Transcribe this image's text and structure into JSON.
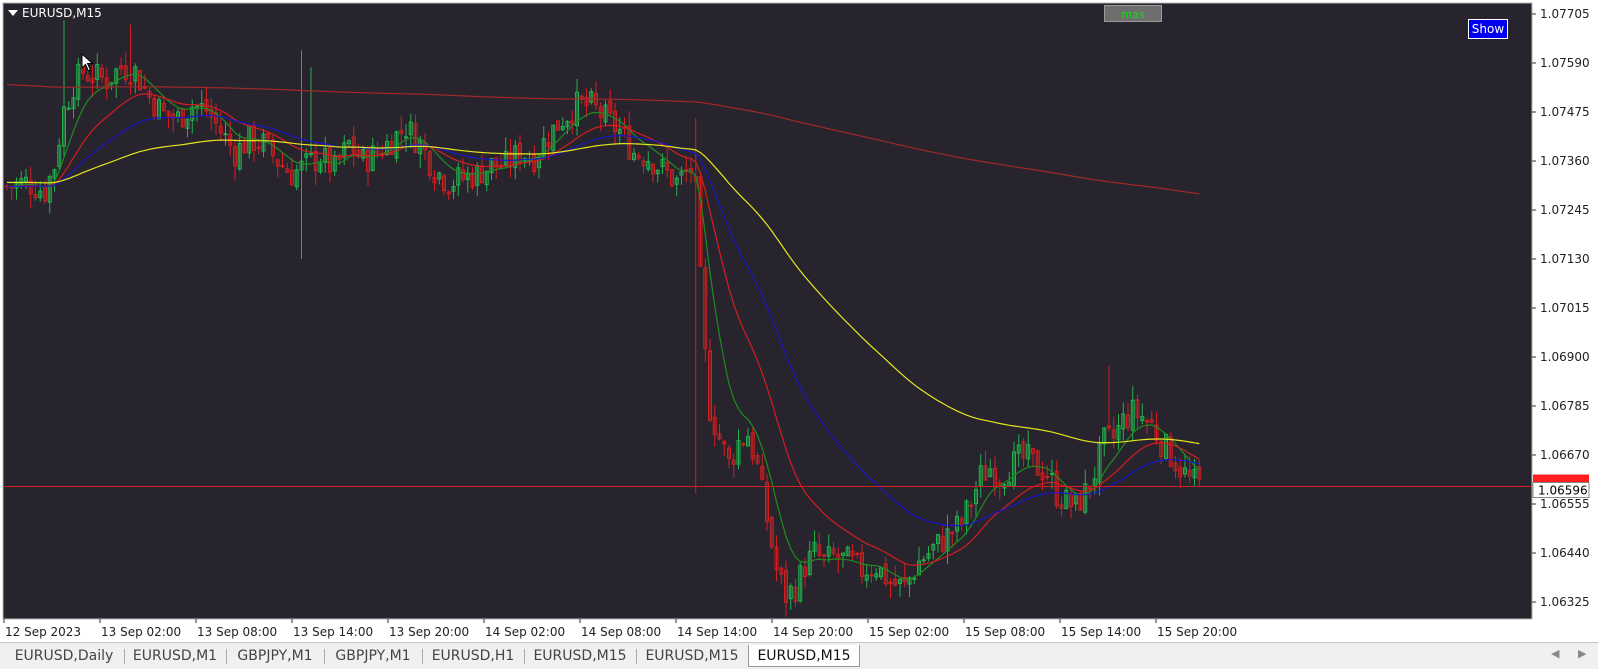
{
  "window": {
    "symbol_label": "EURUSD,M15"
  },
  "buttons": {
    "mas_label": "mas",
    "show_label": "Show"
  },
  "price_axis": {
    "labels": [
      "1.07705",
      "1.07590",
      "1.07475",
      "1.07360",
      "1.07245",
      "1.07130",
      "1.07015",
      "1.06900",
      "1.06785",
      "1.06670",
      "1.06555",
      "1.06440",
      "1.06325"
    ],
    "current_price": "1.06596"
  },
  "time_axis": {
    "labels": [
      "12 Sep 2023",
      "13 Sep 02:00",
      "13 Sep 08:00",
      "13 Sep 14:00",
      "13 Sep 20:00",
      "14 Sep 02:00",
      "14 Sep 08:00",
      "14 Sep 14:00",
      "14 Sep 20:00",
      "15 Sep 02:00",
      "15 Sep 08:00",
      "15 Sep 14:00",
      "15 Sep 20:00"
    ]
  },
  "tabs": [
    {
      "label": "EURUSD,Daily",
      "active": false
    },
    {
      "label": "EURUSD,M1",
      "active": false
    },
    {
      "label": "GBPJPY,M1",
      "active": false
    },
    {
      "label": "GBPJPY,M1",
      "active": false
    },
    {
      "label": "EURUSD,H1",
      "active": false
    },
    {
      "label": "EURUSD,M15",
      "active": false
    },
    {
      "label": "EURUSD,M15",
      "active": false
    },
    {
      "label": "EURUSD,M15",
      "active": true
    }
  ],
  "colors": {
    "background": "#28242e",
    "bull": "#22b14c",
    "bear": "#d21e1e",
    "ma_fast": "#1e8c1e",
    "ma_mid": "#d21e1e",
    "ma_slow": "#1818c8",
    "ma_200": "#e6e61e",
    "ma_long": "#a02828",
    "current_line": "#d21e1e"
  },
  "chart_data": {
    "type": "candlestick",
    "symbol": "EURUSD",
    "timeframe": "M15",
    "ylim": [
      1.0627,
      1.0776
    ],
    "x_ticks": [
      "12 Sep 2023",
      "13 Sep 02:00",
      "13 Sep 08:00",
      "13 Sep 14:00",
      "13 Sep 20:00",
      "14 Sep 02:00",
      "14 Sep 08:00",
      "14 Sep 14:00",
      "14 Sep 20:00",
      "15 Sep 02:00",
      "15 Sep 08:00",
      "15 Sep 14:00",
      "15 Sep 20:00"
    ],
    "y_ticks": [
      1.07705,
      1.0759,
      1.07475,
      1.0736,
      1.07245,
      1.0713,
      1.07015,
      1.069,
      1.06785,
      1.0667,
      1.06555,
      1.0644,
      1.06325
    ],
    "current_price": 1.06596,
    "close_path": [
      [
        0,
        1.073
      ],
      [
        4,
        1.0731
      ],
      [
        8,
        1.0729
      ],
      [
        10,
        1.0735
      ],
      [
        12,
        1.0748
      ],
      [
        14,
        1.0754
      ],
      [
        16,
        1.0757
      ],
      [
        18,
        1.0756
      ],
      [
        21,
        1.0755
      ],
      [
        24,
        1.0758
      ],
      [
        27,
        1.0757
      ],
      [
        30,
        1.0751
      ],
      [
        33,
        1.0747
      ],
      [
        36,
        1.0746
      ],
      [
        39,
        1.0749
      ],
      [
        42,
        1.0748
      ],
      [
        45,
        1.0743
      ],
      [
        48,
        1.0738
      ],
      [
        51,
        1.0741
      ],
      [
        54,
        1.074
      ],
      [
        57,
        1.0736
      ],
      [
        60,
        1.0733
      ],
      [
        63,
        1.0735
      ],
      [
        66,
        1.0737
      ],
      [
        69,
        1.0734
      ],
      [
        72,
        1.074
      ],
      [
        75,
        1.0736
      ],
      [
        78,
        1.0738
      ],
      [
        81,
        1.0741
      ],
      [
        84,
        1.0744
      ],
      [
        87,
        1.074
      ],
      [
        90,
        1.0734
      ],
      [
        93,
        1.0731
      ],
      [
        96,
        1.0732
      ],
      [
        99,
        1.0733
      ],
      [
        102,
        1.0735
      ],
      [
        105,
        1.0735
      ],
      [
        108,
        1.0738
      ],
      [
        111,
        1.0737
      ],
      [
        114,
        1.0742
      ],
      [
        117,
        1.0746
      ],
      [
        120,
        1.0749
      ],
      [
        123,
        1.0749
      ],
      [
        126,
        1.0746
      ],
      [
        129,
        1.0743
      ],
      [
        132,
        1.0738
      ],
      [
        135,
        1.0737
      ],
      [
        138,
        1.0734
      ],
      [
        141,
        1.0731
      ],
      [
        144,
        1.0734
      ],
      [
        145,
        1.0728
      ],
      [
        146,
        1.0708
      ],
      [
        147,
        1.069
      ],
      [
        148,
        1.0678
      ],
      [
        150,
        1.0671
      ],
      [
        152,
        1.0665
      ],
      [
        154,
        1.067
      ],
      [
        156,
        1.0672
      ],
      [
        158,
        1.0664
      ],
      [
        160,
        1.0652
      ],
      [
        162,
        1.064
      ],
      [
        164,
        1.0634
      ],
      [
        166,
        1.0636
      ],
      [
        168,
        1.0641
      ],
      [
        170,
        1.0644
      ],
      [
        172,
        1.0642
      ],
      [
        174,
        1.0643
      ],
      [
        177,
        1.0642
      ],
      [
        180,
        1.064
      ],
      [
        183,
        1.0641
      ],
      [
        186,
        1.0637
      ],
      [
        189,
        1.0636
      ],
      [
        192,
        1.0642
      ],
      [
        195,
        1.0645
      ],
      [
        198,
        1.0648
      ],
      [
        201,
        1.0651
      ],
      [
        203,
        1.0656
      ],
      [
        205,
        1.0662
      ],
      [
        207,
        1.0664
      ],
      [
        209,
        1.0662
      ],
      [
        211,
        1.0664
      ],
      [
        213,
        1.0666
      ],
      [
        215,
        1.0666
      ],
      [
        217,
        1.0664
      ],
      [
        219,
        1.0663
      ],
      [
        221,
        1.0658
      ],
      [
        223,
        1.0656
      ],
      [
        225,
        1.0655
      ],
      [
        227,
        1.0658
      ],
      [
        229,
        1.0663
      ],
      [
        231,
        1.067
      ],
      [
        233,
        1.0671
      ],
      [
        235,
        1.0675
      ],
      [
        237,
        1.0677
      ],
      [
        239,
        1.0676
      ],
      [
        241,
        1.0674
      ],
      [
        243,
        1.067
      ],
      [
        245,
        1.0667
      ],
      [
        247,
        1.0664
      ],
      [
        249,
        1.0661
      ],
      [
        251,
        1.066
      ]
    ],
    "series": [
      {
        "name": "MA",
        "color": "#1e8c1e"
      },
      {
        "name": "MA",
        "color": "#d21e1e"
      },
      {
        "name": "MA",
        "color": "#1818c8"
      },
      {
        "name": "MA",
        "color": "#e6e61e"
      },
      {
        "name": "MA",
        "color": "#a02828"
      }
    ]
  }
}
